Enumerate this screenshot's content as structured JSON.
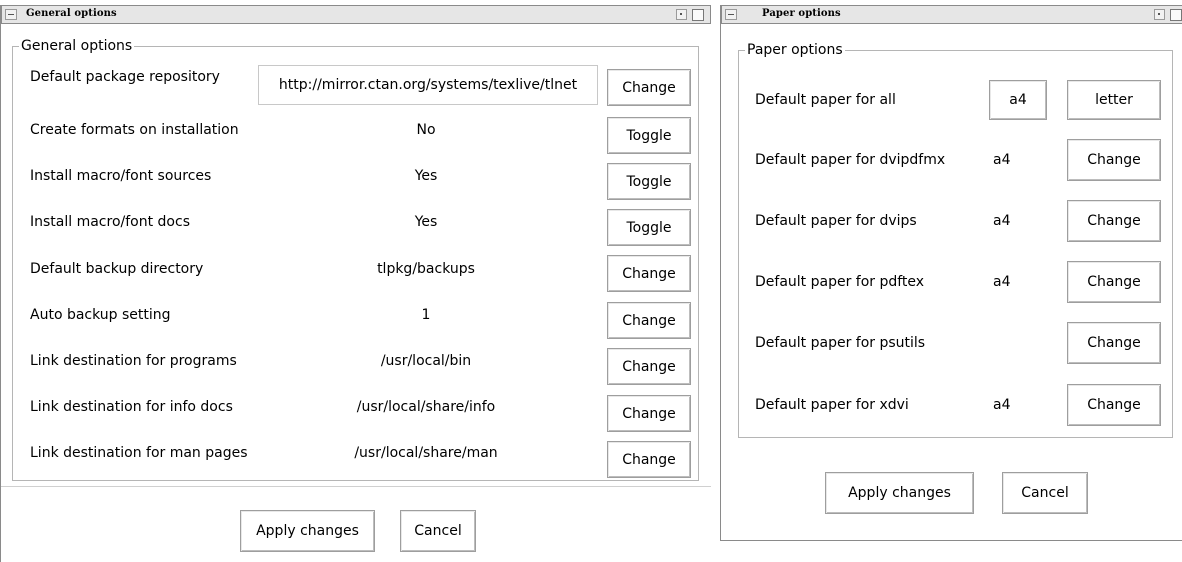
{
  "general_window": {
    "title": "General options",
    "group_legend": "General options",
    "rows": [
      {
        "label": "Default package repository",
        "value": "http://mirror.ctan.org/systems/texlive/tlnet",
        "button": "Change"
      },
      {
        "label": "Create formats on installation",
        "value": "No",
        "button": "Toggle"
      },
      {
        "label": "Install macro/font sources",
        "value": "Yes",
        "button": "Toggle"
      },
      {
        "label": "Install macro/font docs",
        "value": "Yes",
        "button": "Toggle"
      },
      {
        "label": "Default backup directory",
        "value": "tlpkg/backups",
        "button": "Change"
      },
      {
        "label": "Auto backup setting",
        "value": "1",
        "button": "Change"
      },
      {
        "label": "Link destination for programs",
        "value": "/usr/local/bin",
        "button": "Change"
      },
      {
        "label": "Link destination for info docs",
        "value": "/usr/local/share/info",
        "button": "Change"
      },
      {
        "label": "Link destination for man pages",
        "value": "/usr/local/share/man",
        "button": "Change"
      }
    ],
    "apply_label": "Apply changes",
    "cancel_label": "Cancel"
  },
  "paper_window": {
    "title": "Paper options",
    "group_legend": "Paper options",
    "all_row": {
      "label": "Default paper for all",
      "option_a4": "a4",
      "option_letter": "letter"
    },
    "rows": [
      {
        "label": "Default paper for dvipdfmx",
        "value": "a4",
        "button": "Change"
      },
      {
        "label": "Default paper for dvips",
        "value": "a4",
        "button": "Change"
      },
      {
        "label": "Default paper for pdftex",
        "value": "a4",
        "button": "Change"
      },
      {
        "label": "Default paper for psutils",
        "value": "",
        "button": "Change"
      },
      {
        "label": "Default paper for xdvi",
        "value": "a4",
        "button": "Change"
      }
    ],
    "apply_label": "Apply changes",
    "cancel_label": "Cancel"
  },
  "icons": {
    "window_menu": "window-menu-icon",
    "minimize": "minimize-icon",
    "maximize": "maximize-icon"
  }
}
